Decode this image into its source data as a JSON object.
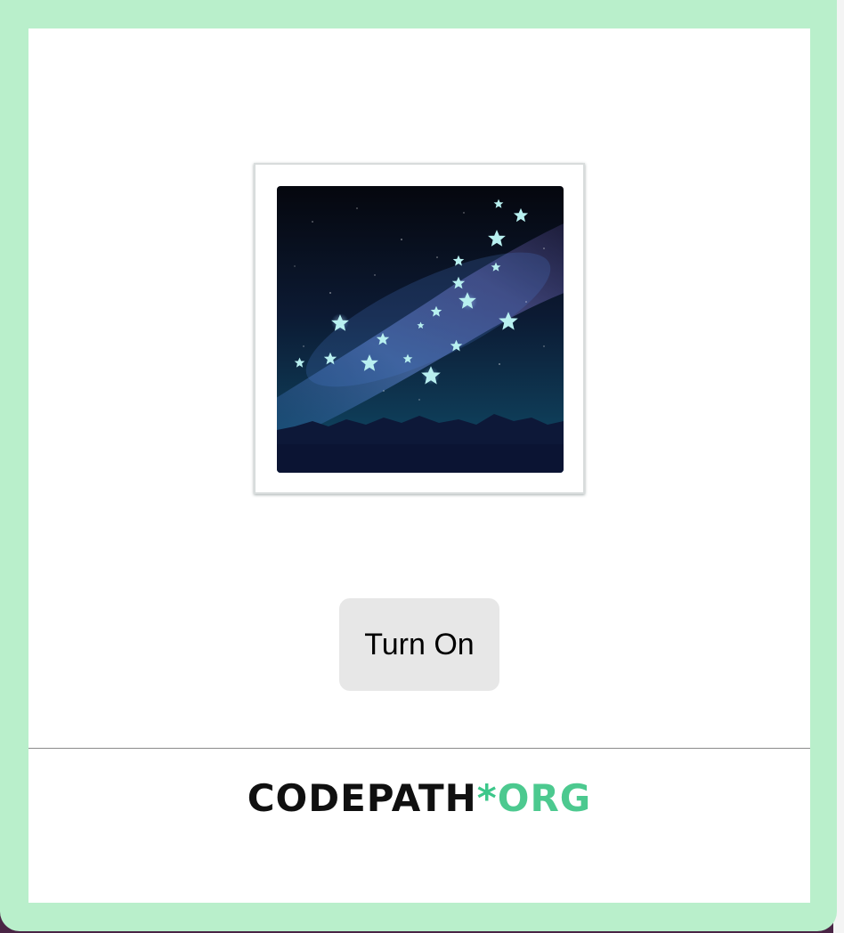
{
  "image": {
    "icon": "milky-way-icon",
    "alt": "Milky Way"
  },
  "button": {
    "label": "Turn On"
  },
  "footer": {
    "logo_main": "CODEPATH",
    "logo_star": "*",
    "logo_org": "ORG"
  },
  "colors": {
    "frame": "#b9efcb",
    "panel": "#ffffff",
    "button_bg": "#e7e7e7",
    "logo_main": "#101010",
    "logo_accent": "#4cc98f"
  }
}
